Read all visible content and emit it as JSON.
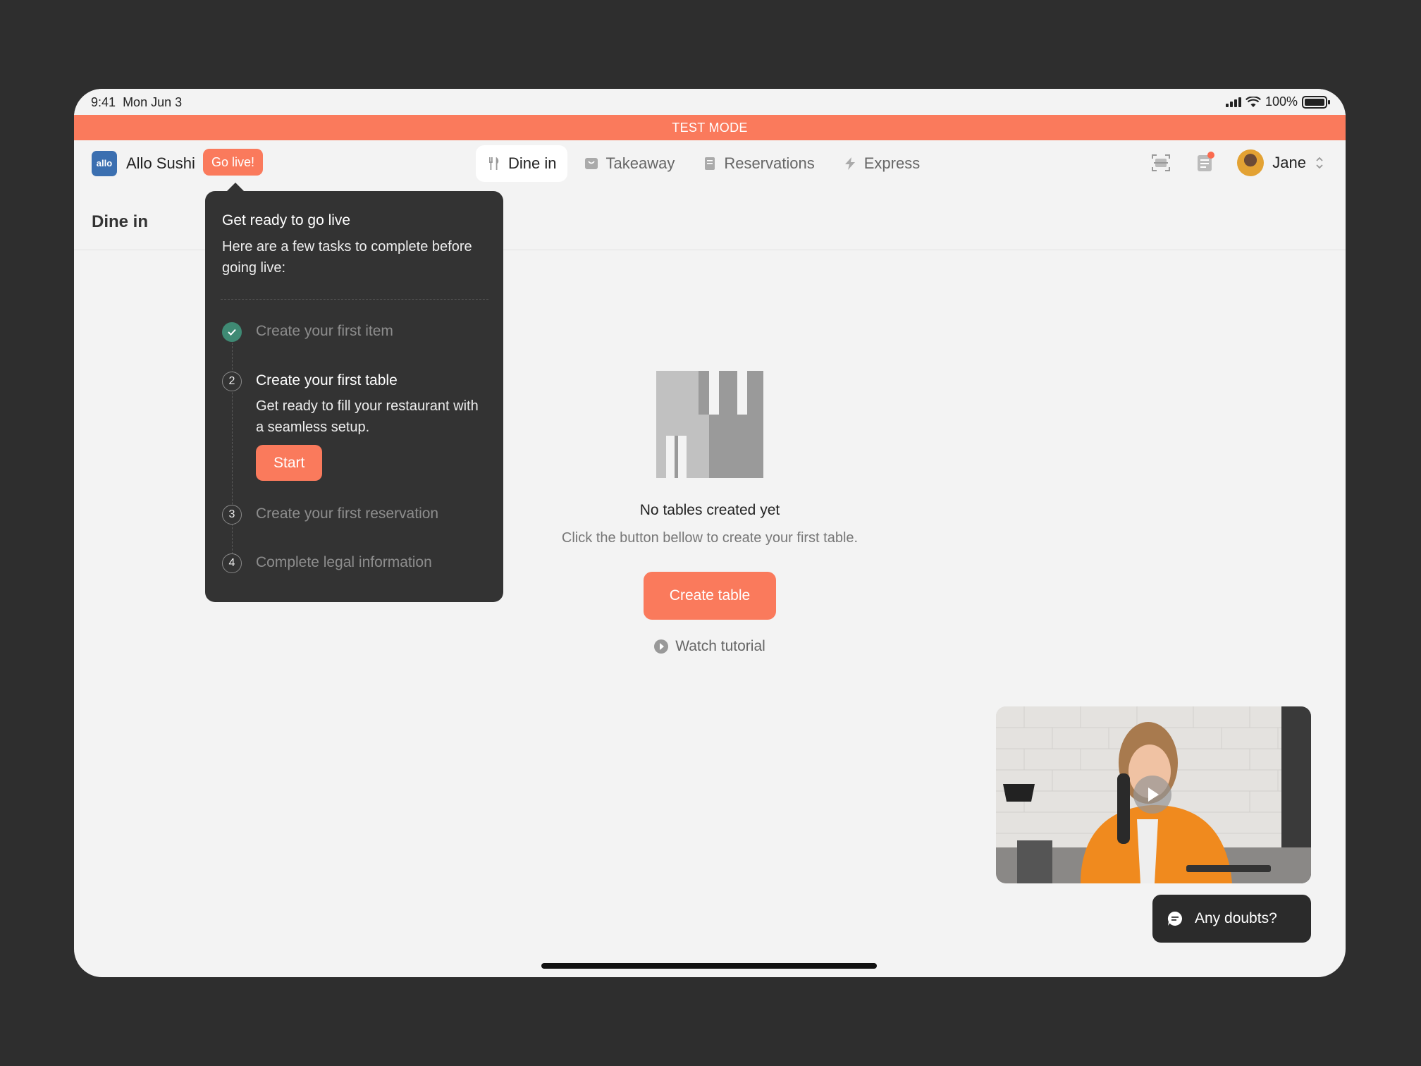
{
  "status": {
    "time": "9:41",
    "date": "Mon Jun 3",
    "battery": "100%"
  },
  "banner": {
    "text": "TEST MODE"
  },
  "brand": {
    "logo_text": "allo",
    "name": "Allo Sushi",
    "go_live_label": "Go live!"
  },
  "tabs": [
    {
      "label": "Dine in",
      "icon": "fork-knife-icon",
      "active": true
    },
    {
      "label": "Takeaway",
      "icon": "bag-icon",
      "active": false
    },
    {
      "label": "Reservations",
      "icon": "book-icon",
      "active": false
    },
    {
      "label": "Express",
      "icon": "bolt-icon",
      "active": false
    }
  ],
  "user": {
    "name": "Jane"
  },
  "page": {
    "title": "Dine in"
  },
  "empty_state": {
    "title": "No tables created yet",
    "subtitle": "Click the button bellow to create your first table.",
    "button": "Create table",
    "tutorial": "Watch tutorial"
  },
  "popover": {
    "title": "Get ready to go live",
    "intro": "Here are a few tasks to complete before going live:",
    "steps": [
      {
        "marker": "",
        "label": "Create your first item",
        "done": true
      },
      {
        "marker": "2",
        "label": "Create your first table",
        "description": "Get ready to fill your restaurant with a seamless setup.",
        "action": "Start"
      },
      {
        "marker": "3",
        "label": "Create your first reservation"
      },
      {
        "marker": "4",
        "label": "Complete legal information"
      }
    ]
  },
  "help": {
    "label": "Any doubts?"
  },
  "colors": {
    "accent": "#fa7a5c",
    "dark": "#333333",
    "success": "#3f8a74"
  }
}
